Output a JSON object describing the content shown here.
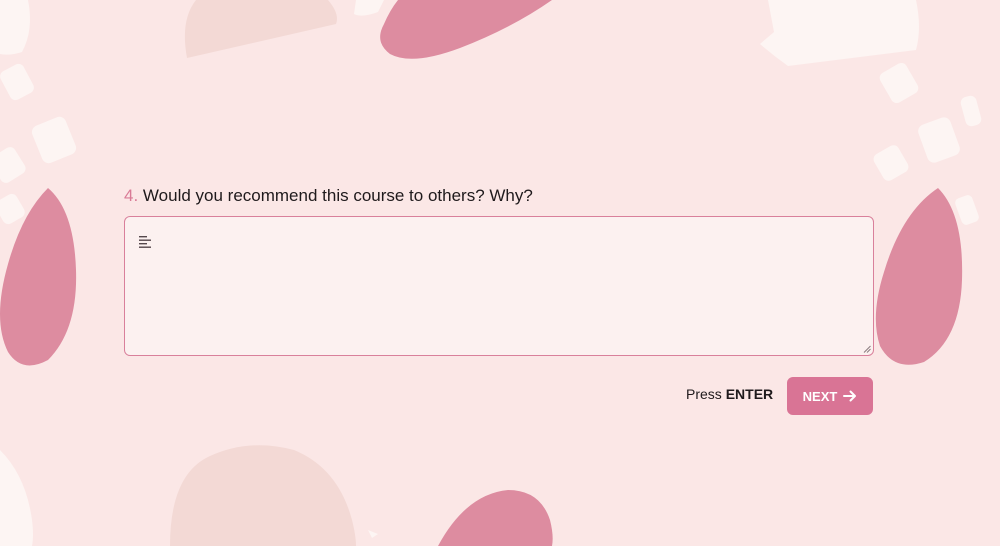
{
  "question": {
    "number": "4.",
    "text": "Would you recommend this course to others? Why?"
  },
  "answer": {
    "value": "",
    "placeholder": ""
  },
  "footer": {
    "press_label": "Press",
    "key_label": "ENTER",
    "next_label": "NEXT"
  },
  "icons": {
    "text_lines": "text-lines-icon",
    "next_arrow": "arrow-right-icon",
    "resize": "resize-handle-icon"
  },
  "colors": {
    "background": "#fbe7e6",
    "accent": "#d97495",
    "blob_dark": "#dd8ca0",
    "blob_tan": "#f3d9d5",
    "blob_light": "#fdf5f3"
  }
}
